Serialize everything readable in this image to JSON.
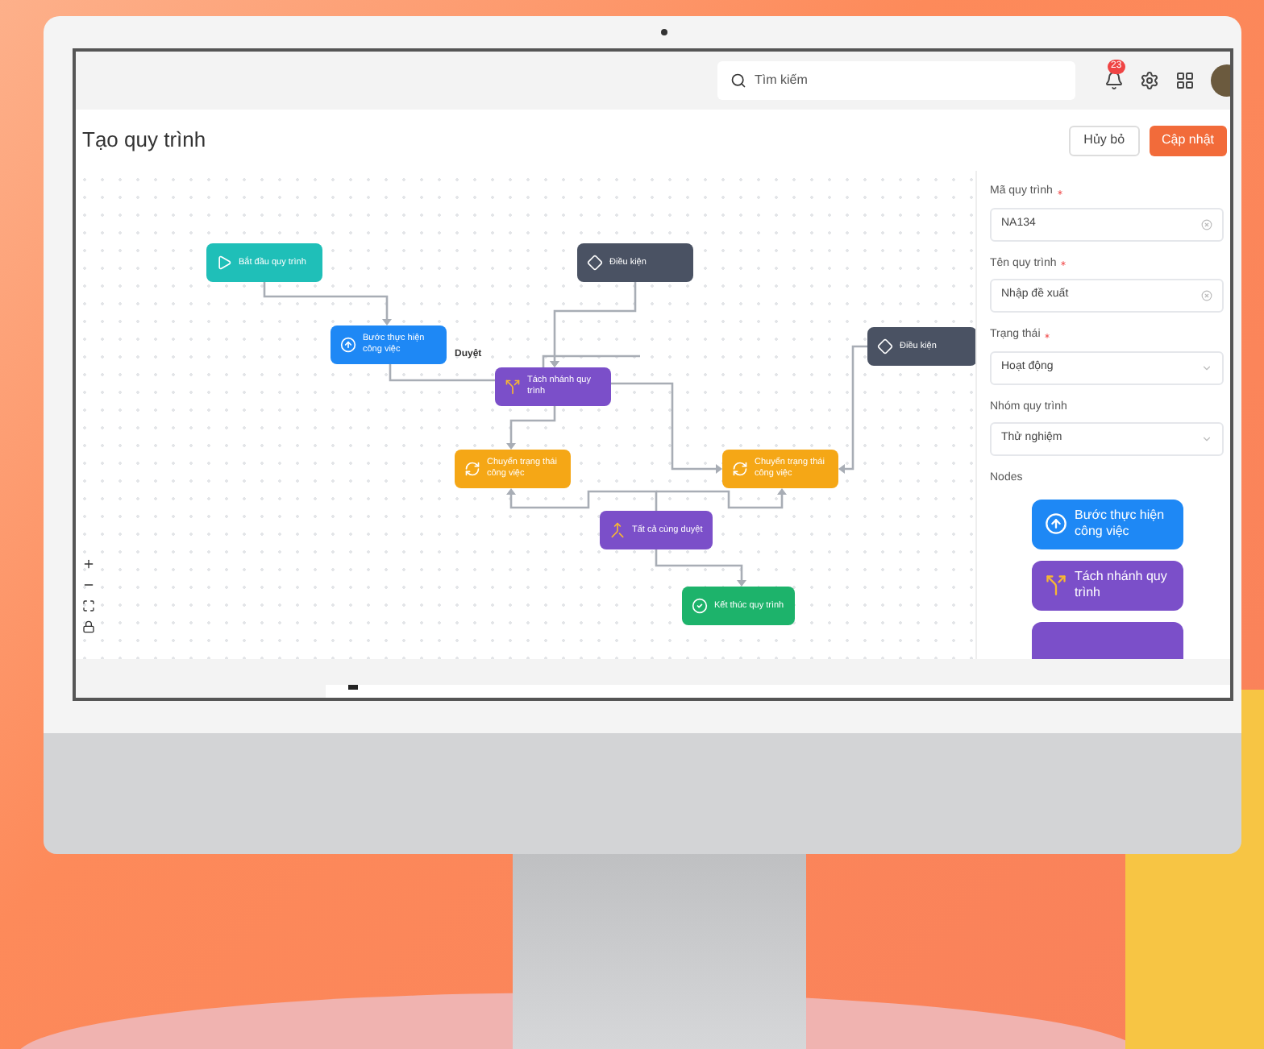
{
  "header": {
    "search": {
      "placeholder": "Tìm kiếm"
    },
    "notifications": {
      "count": "23"
    }
  },
  "page": {
    "title": "Tạo quy trình",
    "buttons": [
      {
        "kind": "secondary",
        "label": "Hủy bỏ"
      },
      {
        "kind": "primary",
        "label": "Cập nhật"
      }
    ]
  },
  "canvas": {
    "nodes": [
      {
        "kind": "start",
        "label": "Bắt đầu quy trình",
        "color": "#1fbfb8"
      },
      {
        "kind": "condition",
        "label": "Điều kiện",
        "color": "#4a5263"
      },
      {
        "kind": "task",
        "label": "Bước thực hiện công việc",
        "color": "#1e88f5"
      },
      {
        "kind": "condition",
        "label": "Điều kiện",
        "color": "#4a5263"
      },
      {
        "kind": "split",
        "label": "Tách nhánh quy trình",
        "color": "#7b4fc9"
      },
      {
        "kind": "status",
        "label": "Chuyển trạng thái công việc",
        "color": "#f5a716"
      },
      {
        "kind": "status",
        "label": "Chuyển trạng thái công việc",
        "color": "#f5a716"
      },
      {
        "kind": "join",
        "label": "Tất cả cùng duyệt",
        "color": "#7b4fc9"
      },
      {
        "kind": "end",
        "label": "Kết thúc quy trình",
        "color": "#1db36b"
      }
    ],
    "edge_label": "Duyệt"
  },
  "form": {
    "fields": [
      {
        "kind": "text",
        "label": "Mã quy trình",
        "required": true,
        "value": "NA134"
      },
      {
        "kind": "text",
        "label": "Tên quy trình",
        "required": true,
        "value": "Nhập đề xuất"
      },
      {
        "kind": "select",
        "label": "Trạng thái",
        "required": true,
        "value": "Hoạt động"
      },
      {
        "kind": "select",
        "label": "Nhóm quy trình",
        "required": false,
        "value": "Thử nghiệm"
      }
    ],
    "nodes_title": "Nodes",
    "palette": [
      {
        "kind": "task",
        "label": "Bước thực hiện công việc",
        "color": "#1e88f5"
      },
      {
        "kind": "split",
        "label": "Tách nhánh quy trình",
        "color": "#7b4fc9"
      },
      {
        "color": "#7b4fc9"
      }
    ]
  }
}
